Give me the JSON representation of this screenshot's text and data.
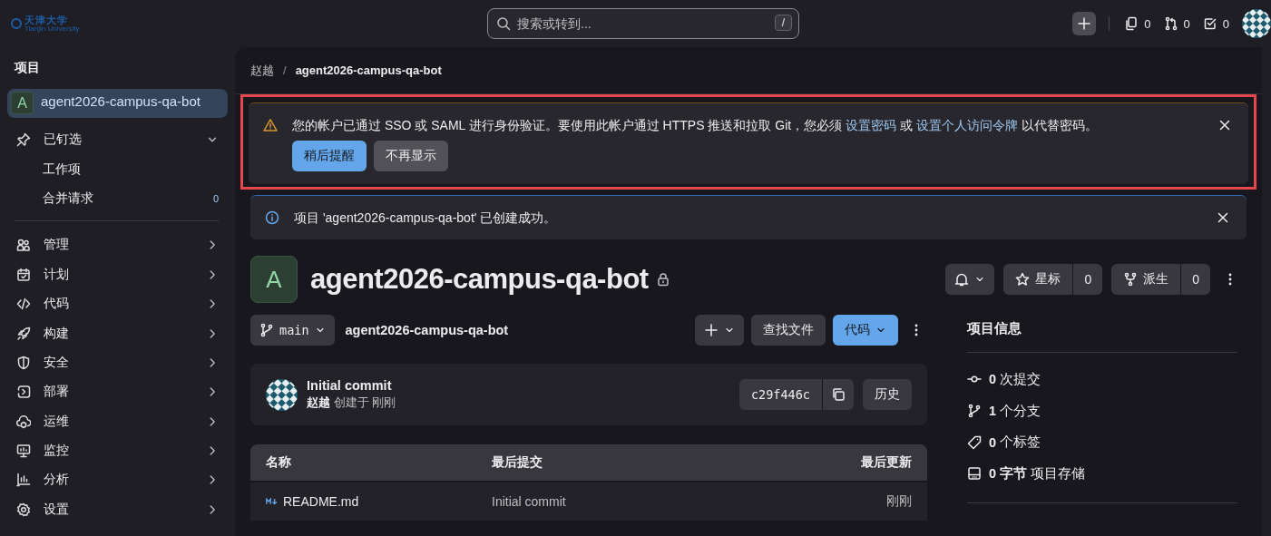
{
  "top_bar": {
    "logo": {
      "name": "天津大学",
      "subtitle": "Tianjin University"
    },
    "search": {
      "placeholder": "搜索或转到...",
      "shortcut": "/"
    },
    "counters": [
      {
        "kind": "issues",
        "count": "0"
      },
      {
        "kind": "merge",
        "count": "0"
      },
      {
        "kind": "todo",
        "count": "0"
      }
    ]
  },
  "sidebar": {
    "section_title": "项目",
    "project": {
      "avatar": "A",
      "name": "agent2026-campus-qa-bot",
      "selected": true
    },
    "pinned": {
      "label": "已钉选",
      "expanded": true,
      "items": [
        {
          "label": "工作项"
        },
        {
          "label": "合并请求",
          "count": "0"
        }
      ]
    },
    "items": [
      {
        "kind": "people",
        "label": "管理"
      },
      {
        "kind": "calendar",
        "label": "计划"
      },
      {
        "kind": "code",
        "label": "代码"
      },
      {
        "kind": "rocket",
        "label": "构建"
      },
      {
        "kind": "shield",
        "label": "安全"
      },
      {
        "kind": "deploy",
        "label": "部署"
      },
      {
        "kind": "cloud",
        "label": "运维"
      },
      {
        "kind": "monitor",
        "label": "监控"
      },
      {
        "kind": "chart",
        "label": "分析"
      },
      {
        "kind": "gear",
        "label": "设置"
      }
    ]
  },
  "breadcrumb": {
    "separator": "/",
    "items": [
      "赵越",
      "agent2026-campus-qa-bot"
    ]
  },
  "alerts": [
    {
      "kind": "warning",
      "highlighted": true,
      "parts": [
        {
          "text": "您的帐户已通过 SSO 或 SAML 进行身份验证。要使用此帐户通过 HTTPS 推送和拉取 Git，您必须 "
        },
        {
          "link": "设置密码"
        },
        {
          "text": " 或 "
        },
        {
          "link": "设置个人访问令牌"
        },
        {
          "text": " 以代替密码。"
        }
      ],
      "buttons": [
        {
          "label": "稍后提醒",
          "kind": "primary"
        },
        {
          "label": "不再显示",
          "kind": "secondary"
        }
      ]
    },
    {
      "kind": "info",
      "highlighted": false,
      "parts": [
        {
          "text": "项目 'agent2026-campus-qa-bot' 已创建成功。"
        }
      ]
    }
  ],
  "project": {
    "avatar": "A",
    "title": "agent2026-campus-qa-bot",
    "private": true,
    "star": {
      "label": "星标",
      "count": "0"
    },
    "fork": {
      "label": "派生",
      "count": "0"
    }
  },
  "repo_toolbar": {
    "branch": "main",
    "path": "agent2026-campus-qa-bot",
    "find_file": "查找文件",
    "code": "代码"
  },
  "last_commit": {
    "title": "Initial commit",
    "author": "赵越",
    "meta": "创建于 刚刚",
    "sha": "c29f446c",
    "history": "历史"
  },
  "files": {
    "columns": [
      "名称",
      "最后提交",
      "最后更新"
    ],
    "rows": [
      {
        "name": "README.md",
        "commit": "Initial commit",
        "updated": "刚刚"
      }
    ]
  },
  "project_info": {
    "title": "项目信息",
    "stats": [
      {
        "kind": "commit",
        "value": "0",
        "label": "次提交"
      },
      {
        "kind": "branch",
        "value": "1",
        "label": "个分支"
      },
      {
        "kind": "tag",
        "value": "0",
        "label": "个标签"
      },
      {
        "kind": "storage",
        "value": "0 字节",
        "label": "项目存储"
      }
    ]
  }
}
